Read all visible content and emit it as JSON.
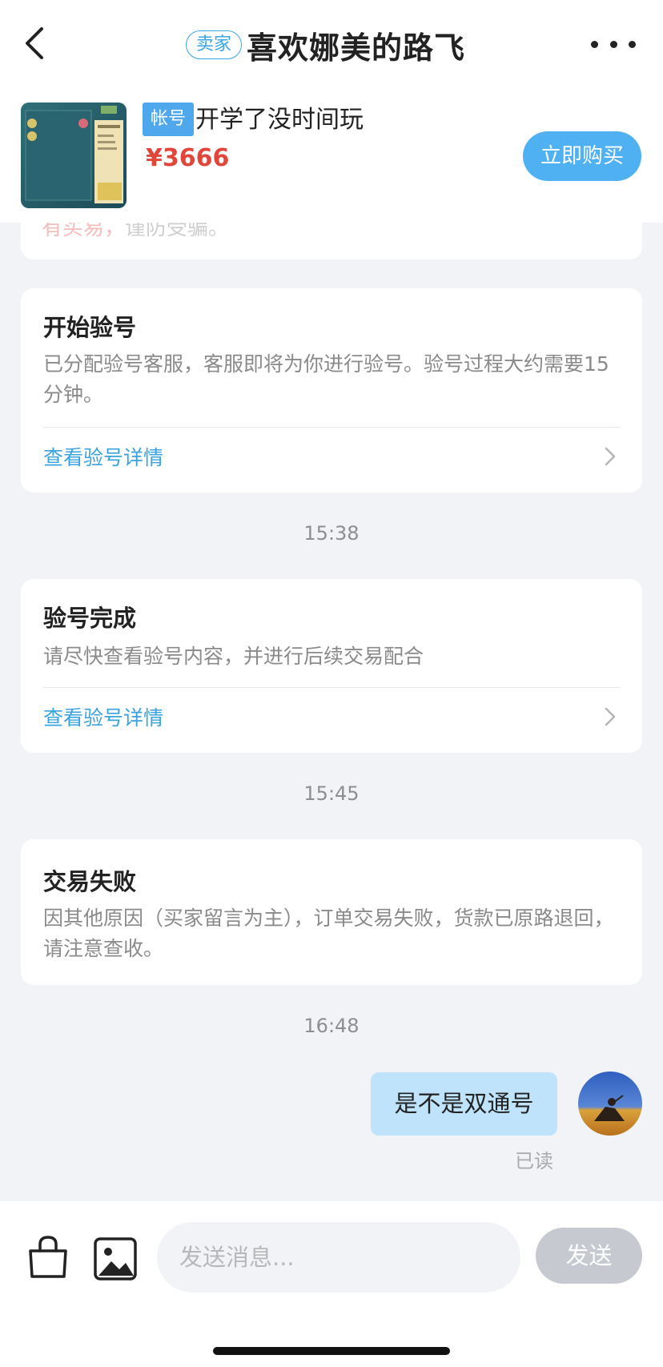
{
  "header": {
    "badge": "卖家",
    "title": "喜欢娜美的路飞"
  },
  "product": {
    "badge": "帐号",
    "title": "开学了没时间玩",
    "price": "¥3666",
    "buy_label": "立即购买"
  },
  "partial_card": {
    "red_text": "有买易，",
    "text": "谨防受骗。"
  },
  "messages": [
    {
      "title": "开始验号",
      "desc": "已分配验号客服，客服即将为你进行验号。验号过程大约需要15分钟。",
      "link": "查看验号详情"
    },
    {
      "time": "15:38",
      "title": "验号完成",
      "desc": "请尽快查看验号内容，并进行后续交易配合",
      "link": "查看验号详情"
    },
    {
      "time": "15:45",
      "title": "交易失败",
      "desc": "因其他原因（买家留言为主），订单交易失败，货款已原路退回，请注意查收。"
    },
    {
      "time": "16:48",
      "bubble": "是不是双通号",
      "status": "已读"
    }
  ],
  "input": {
    "placeholder": "发送消息...",
    "send_label": "发送"
  },
  "colors": {
    "accent": "#4fb0f2",
    "price": "#e2453a",
    "link": "#3aa2de",
    "bubble": "#bfe3fb"
  }
}
